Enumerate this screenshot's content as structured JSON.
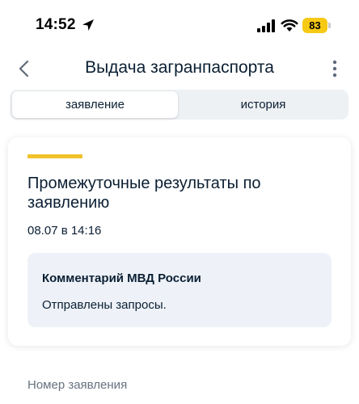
{
  "status_bar": {
    "time": "14:52",
    "battery": "83",
    "battery_color": "#f6c915"
  },
  "header": {
    "title": "Выдача загранпаспорта",
    "back_icon": "chevron-left-icon",
    "more_icon": "more-vertical-icon"
  },
  "tabs": [
    {
      "label": "заявление",
      "active": true
    },
    {
      "label": "история",
      "active": false
    }
  ],
  "card": {
    "accent_color": "#f0c22b",
    "title": "Промежуточные результаты по заявлению",
    "date": "08.07 в 14:16",
    "comment": {
      "heading": "Комментарий МВД России",
      "text": "Отправлены запросы."
    }
  },
  "details": {
    "application_number_label": "Номер заявления"
  }
}
